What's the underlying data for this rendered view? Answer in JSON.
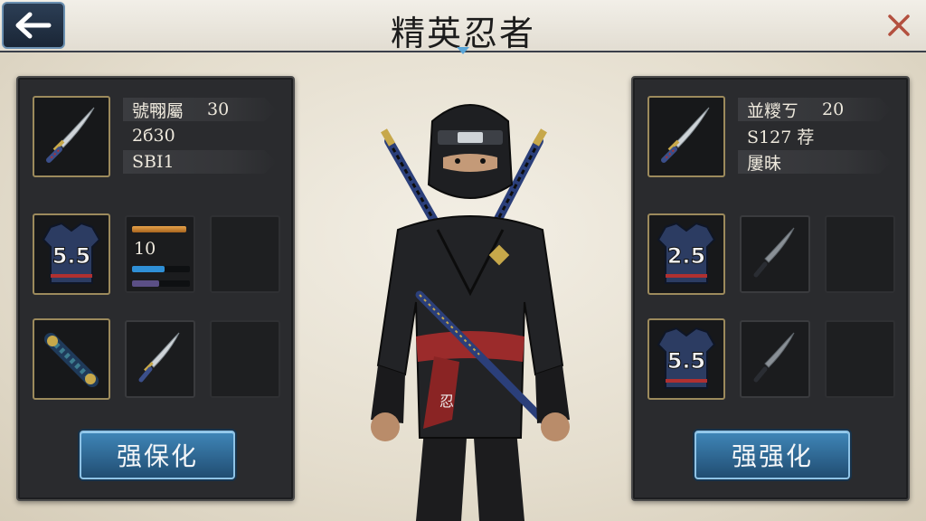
{
  "header": {
    "title": "精英忍者"
  },
  "left_panel": {
    "stats": [
      {
        "label": "號翈屬",
        "value": "30"
      },
      {
        "label": "2б30",
        "value": ""
      },
      {
        "label": "SBI1",
        "value": ""
      }
    ],
    "armor_badge": "5.5",
    "stat_value": "10",
    "enhance_label": "强保化"
  },
  "right_panel": {
    "stats": [
      {
        "label": "並糭ㄎ",
        "value": "20"
      },
      {
        "label": "S127 荐",
        "value": ""
      },
      {
        "label": "屢昧",
        "value": ""
      }
    ],
    "armor_badges": [
      "2.5",
      "5.5"
    ],
    "enhance_label": "强强化"
  },
  "colors": {
    "panel_bg": "#2a2b2e",
    "button_blue": "#2f6f9f",
    "slot_gold_border": "#9c8a5c",
    "sash_red": "#9b2b2b"
  },
  "icons": [
    "back-arrow-icon",
    "close-icon",
    "katana-icon",
    "armor-vest-icon",
    "sword-scroll-icon"
  ]
}
